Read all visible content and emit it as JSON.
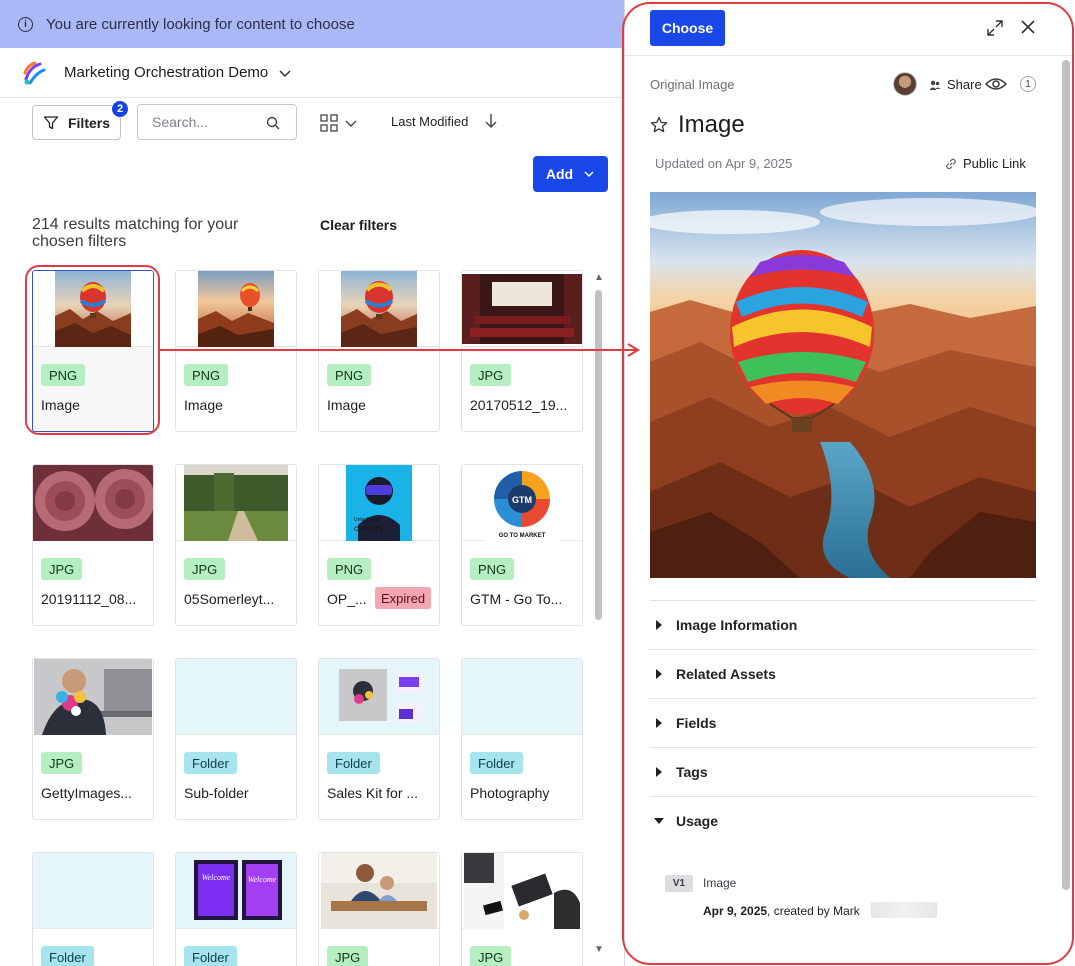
{
  "banner": {
    "text": "You are currently looking for content to choose"
  },
  "org": {
    "name": "Marketing Orchestration Demo"
  },
  "toolbar": {
    "filters_label": "Filters",
    "filters_count": "2",
    "search_placeholder": "Search...",
    "sort_label": "Last Modified",
    "add_label": "Add"
  },
  "results": {
    "text": "214 results matching for your chosen filters",
    "clear_label": "Clear filters"
  },
  "cards": [
    {
      "type": "PNG",
      "title": "Image",
      "expired": ""
    },
    {
      "type": "PNG",
      "title": "Image",
      "expired": ""
    },
    {
      "type": "PNG",
      "title": "Image",
      "expired": ""
    },
    {
      "type": "JPG",
      "title": "20170512_19...",
      "expired": ""
    },
    {
      "type": "JPG",
      "title": "20191112_08...",
      "expired": ""
    },
    {
      "type": "JPG",
      "title": "05Somerleyt...",
      "expired": ""
    },
    {
      "type": "PNG",
      "title": "OP_...",
      "expired": "Expired"
    },
    {
      "type": "PNG",
      "title": "GTM - Go To...",
      "expired": ""
    },
    {
      "type": "JPG",
      "title": "GettyImages...",
      "expired": ""
    },
    {
      "type": "Folder",
      "title": "Sub-folder",
      "expired": ""
    },
    {
      "type": "Folder",
      "title": "Sales Kit for ...",
      "expired": ""
    },
    {
      "type": "Folder",
      "title": "Photography",
      "expired": ""
    },
    {
      "type": "Folder",
      "title": "",
      "expired": ""
    },
    {
      "type": "Folder",
      "title": "",
      "expired": ""
    },
    {
      "type": "JPG",
      "title": "",
      "expired": ""
    },
    {
      "type": "JPG",
      "title": "",
      "expired": ""
    }
  ],
  "thumb_text": {
    "curiosity": "curiosity",
    "gtm": "GTM",
    "gtm_sub": "GO TO MARKET",
    "welcome": "Welcome"
  },
  "detail": {
    "choose_label": "Choose",
    "original_label": "Original Image",
    "share_label": "Share",
    "view_count": "1",
    "title": "Image",
    "updated": "Updated on Apr 9, 2025",
    "public_link": "Public Link",
    "sections": [
      {
        "label": "Image Information",
        "open": false
      },
      {
        "label": "Related Assets",
        "open": false
      },
      {
        "label": "Fields",
        "open": false
      },
      {
        "label": "Tags",
        "open": false
      },
      {
        "label": "Usage",
        "open": true
      }
    ],
    "usage": {
      "version": "V1",
      "item": "Image",
      "date": "Apr 9, 2025",
      "created_by": ", created by Mark"
    }
  },
  "colors": {
    "accent": "#1a47e8",
    "banner": "#aab8f7",
    "annotation": "#e23b44",
    "tag_file": "#b5eec1",
    "tag_folder": "#a7e5ee",
    "expired": "#f5a6b3"
  }
}
